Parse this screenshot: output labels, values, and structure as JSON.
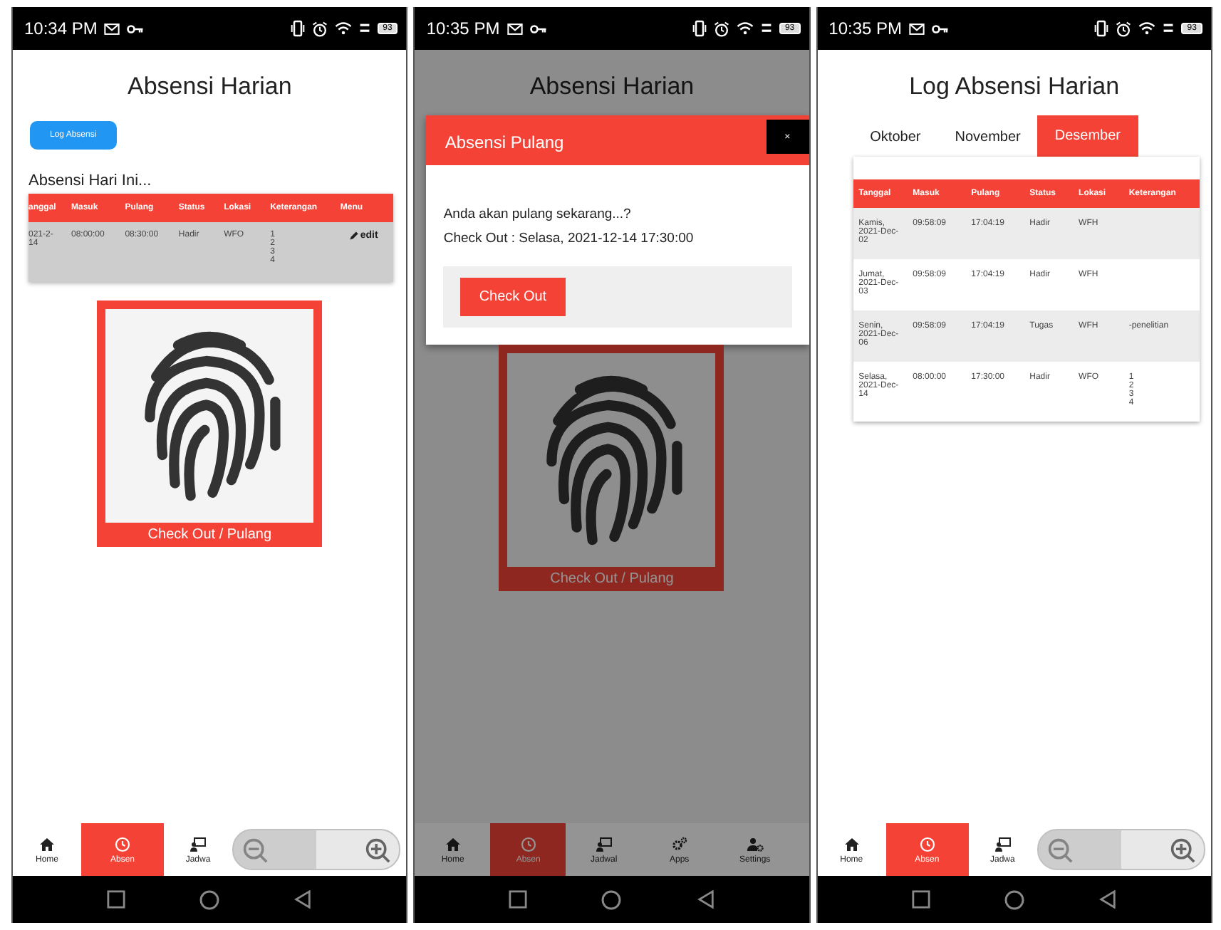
{
  "phones": [
    {
      "status_bar": {
        "time": "10:34 PM",
        "battery": "93"
      },
      "dimmed": false,
      "title": "Absensi Harian",
      "log_button": "Log Absensi",
      "section_title": "Absensi Hari Ini...",
      "table": {
        "columns": [
          "anggal",
          "Masuk",
          "Pulang",
          "Status",
          "Lokasi",
          "Keterangan",
          "Menu"
        ],
        "rows": [
          {
            "cells": [
              "021-2-14",
              "08:00:00",
              "08:30:00",
              "Hadir",
              "WFO",
              "1\n2\n3\n4"
            ],
            "action": "edit"
          }
        ]
      },
      "scan_card": {
        "label": "Check Out / Pulang"
      },
      "nav": {
        "items": [
          {
            "label": "Home",
            "kind": "home",
            "selected": false
          },
          {
            "label": "Absen",
            "kind": "clock",
            "selected": true
          },
          {
            "label": "Jadwa",
            "kind": "board",
            "selected": false
          }
        ],
        "zoom_overlay": true
      }
    },
    {
      "status_bar": {
        "time": "10:35 PM",
        "battery": "93"
      },
      "dimmed": true,
      "title": "Absensi Harian",
      "modal": {
        "title": "Absensi Pulang",
        "close": "×",
        "lines": [
          "Anda akan pulang sekarang...?",
          "Check Out : Selasa, 2021-12-14 17:30:00"
        ],
        "button": "Check Out"
      },
      "scan_card": {
        "label": "Check Out / Pulang"
      },
      "nav": {
        "items": [
          {
            "label": "Home",
            "kind": "home",
            "selected": false
          },
          {
            "label": "Absen",
            "kind": "clock",
            "selected": true
          },
          {
            "label": "Jadwal",
            "kind": "board",
            "selected": false
          },
          {
            "label": "Apps",
            "kind": "gears",
            "selected": false
          },
          {
            "label": "Settings",
            "kind": "usergear",
            "selected": false
          }
        ],
        "zoom_overlay": false
      }
    },
    {
      "status_bar": {
        "time": "10:35 PM",
        "battery": "93"
      },
      "dimmed": false,
      "title": "Log Absensi Harian",
      "tabs": [
        {
          "label": "Oktober",
          "selected": false
        },
        {
          "label": "November",
          "selected": false
        },
        {
          "label": "Desember",
          "selected": true
        }
      ],
      "log_table": {
        "columns": [
          "Tanggal",
          "Masuk",
          "Pulang",
          "Status",
          "Lokasi",
          "Keterangan"
        ],
        "rows": [
          {
            "cells": [
              "Kamis, 2021-Dec-02",
              "09:58:09",
              "17:04:19",
              "Hadir",
              "WFH",
              ""
            ]
          },
          {
            "cells": [
              "Jumat, 2021-Dec-03",
              "09:58:09",
              "17:04:19",
              "Hadir",
              "WFH",
              ""
            ]
          },
          {
            "cells": [
              "Senin, 2021-Dec-06",
              "09:58:09",
              "17:04:19",
              "Tugas",
              "WFH",
              "-penelitian"
            ]
          },
          {
            "cells": [
              "Selasa, 2021-Dec-14",
              "08:00:00",
              "17:30:00",
              "Hadir",
              "WFO",
              "1\n2\n3\n4"
            ]
          }
        ]
      },
      "nav": {
        "items": [
          {
            "label": "Home",
            "kind": "home",
            "selected": false
          },
          {
            "label": "Absen",
            "kind": "clock",
            "selected": true
          },
          {
            "label": "Jadwa",
            "kind": "board",
            "selected": false
          }
        ],
        "zoom_overlay": true
      }
    }
  ]
}
